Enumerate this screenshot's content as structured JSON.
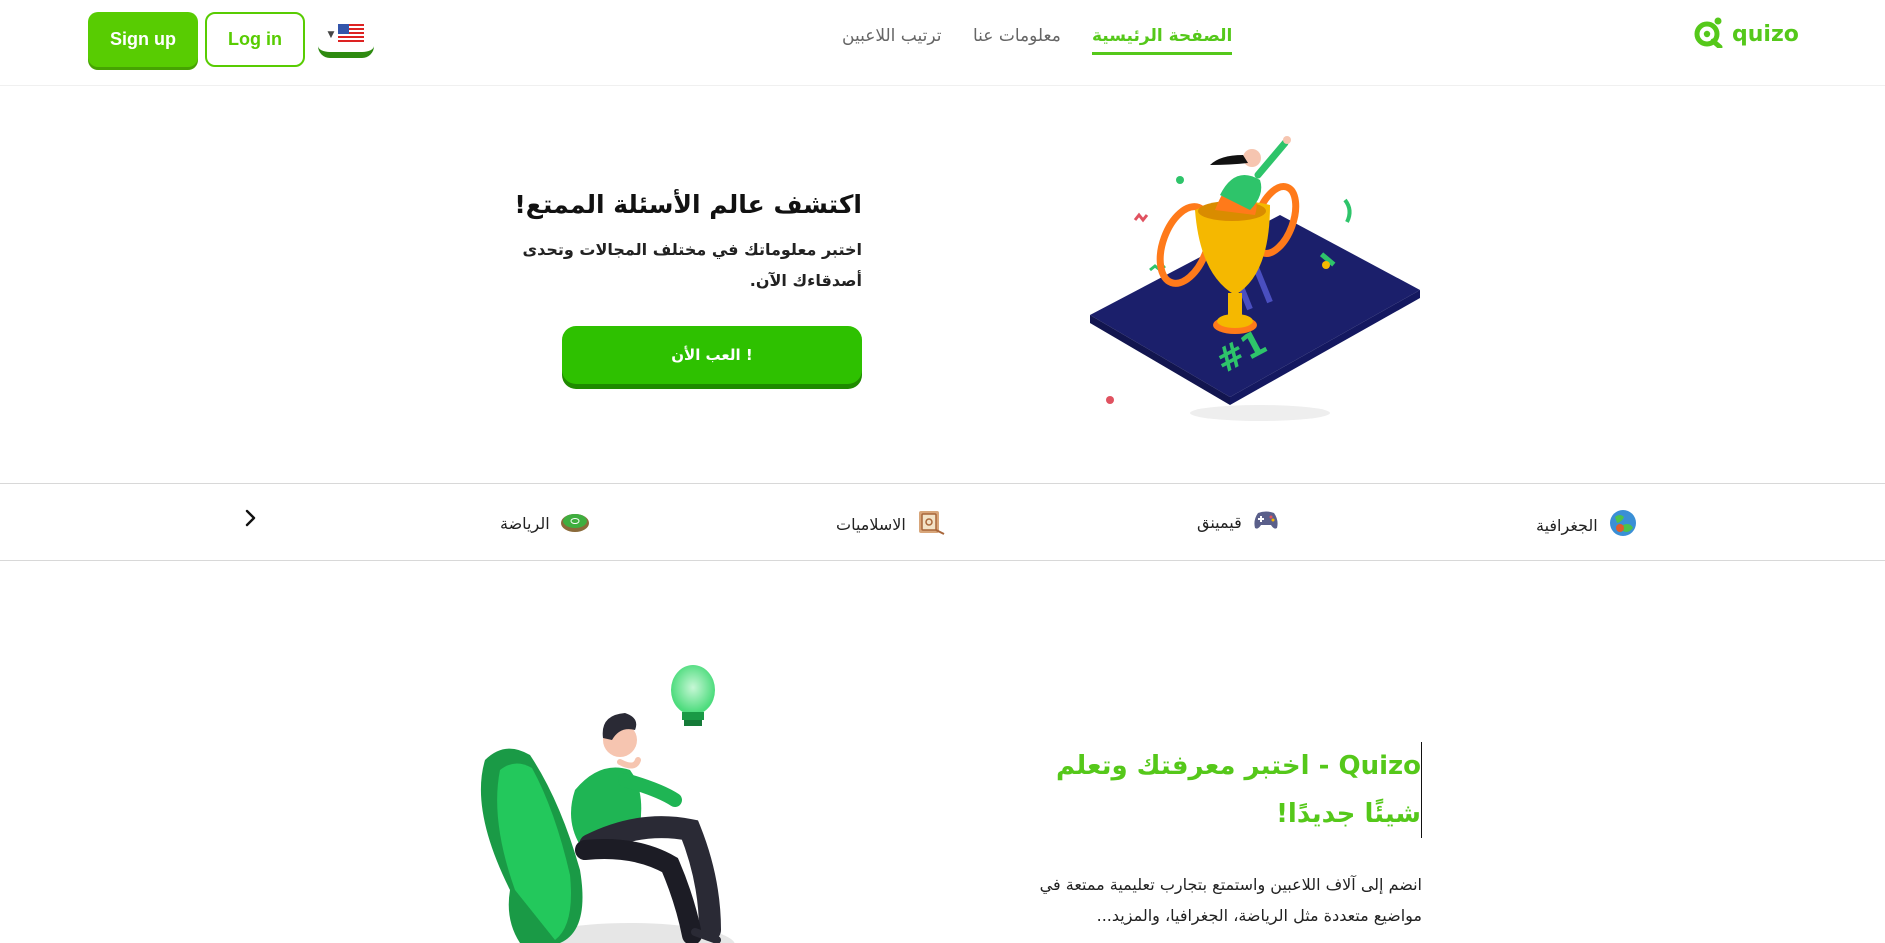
{
  "header": {
    "logo_text": "quizo",
    "nav": {
      "home": "الصفحة الرئيسية",
      "about": "معلومات عنا",
      "ranking": "ترتيب اللاعبين"
    },
    "signup_label": "Sign up",
    "login_label": "Log in",
    "language_flag": "us-flag-icon"
  },
  "hero": {
    "title": "اكتشف عالم الأسئلة الممتع!",
    "subtitle": "اختبر معلوماتك في مختلف المجالات وتحدى أصدقاءك الآن.",
    "play_button": "العب الأن !",
    "illustration_icon": "trophy-illustration-icon"
  },
  "categories": {
    "items": [
      {
        "label": "الجغرافية",
        "icon": "globe-icon"
      },
      {
        "label": "قيمينق",
        "icon": "gamepad-icon"
      },
      {
        "label": "الاسلاميات",
        "icon": "book-icon"
      },
      {
        "label": "الرياضة",
        "icon": "stadium-icon"
      }
    ],
    "next_icon": "chevron-right-icon"
  },
  "info": {
    "title": "Quizo - اختبر معرفتك وتعلم شيئًا جديدًا!",
    "text": "انضم إلى آلاف اللاعبين واستمتع بتجارب تعليمية ممتعة في مواضيع متعددة مثل الرياضة، الجغرافيا، والمزيد...",
    "illustration_icon": "thinking-person-illustration-icon"
  },
  "colors": {
    "brand_green": "#55c81a",
    "button_green": "#2ec100",
    "dark_navy": "#1b1f6b",
    "trophy_gold": "#f5b800"
  }
}
